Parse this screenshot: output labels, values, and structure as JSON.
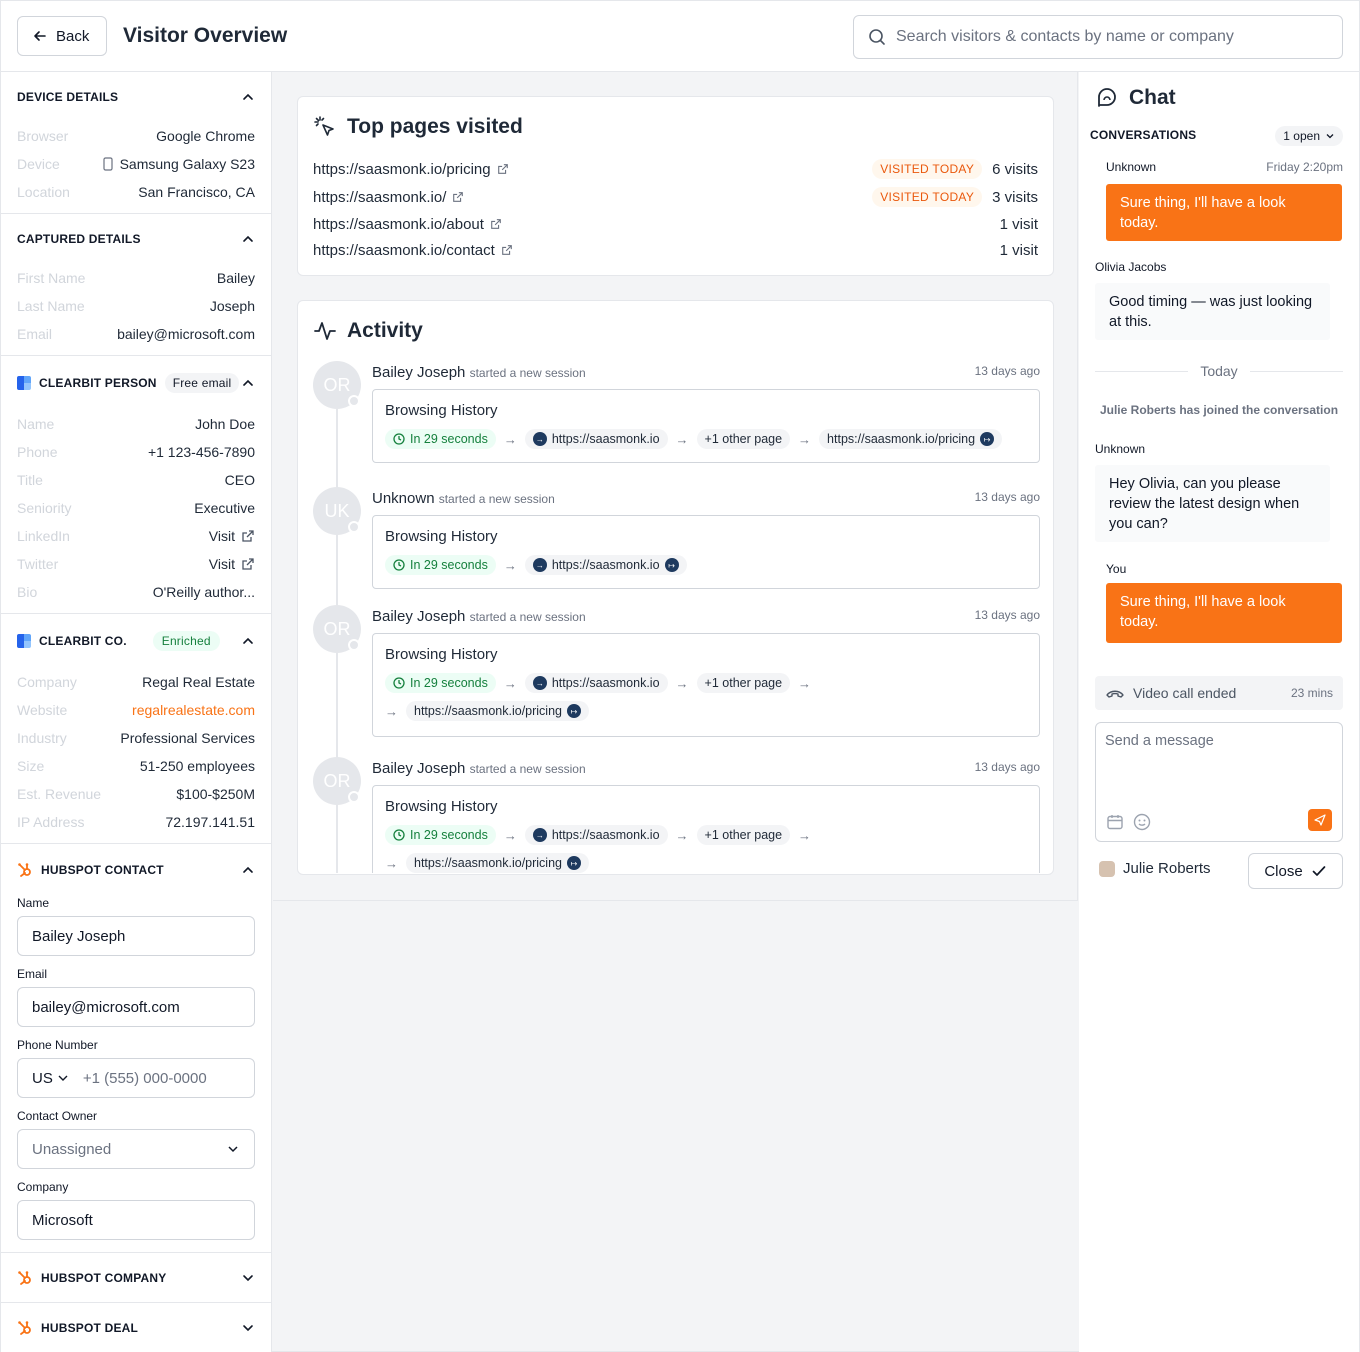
{
  "header": {
    "back_label": "Back",
    "title": "Visitor Overview",
    "search_placeholder": "Search visitors & contacts by name or company"
  },
  "device_details": {
    "title": "DEVICE DETAILS",
    "rows": [
      {
        "key": "Browser",
        "value": "Google Chrome"
      },
      {
        "key": "Device",
        "value": "Samsung Galaxy S23"
      },
      {
        "key": "Location",
        "value": "San Francisco, CA"
      }
    ]
  },
  "captured_details": {
    "title": "CAPTURED DETAILS",
    "rows": [
      {
        "key": "First Name",
        "value": "Bailey"
      },
      {
        "key": "Last Name",
        "value": "Joseph"
      },
      {
        "key": "Email",
        "value": "bailey@microsoft.com"
      }
    ]
  },
  "clearbit_person": {
    "title": "CLEARBIT PERSON",
    "badge": "Free email",
    "rows": [
      {
        "key": "Name",
        "value": "John Doe"
      },
      {
        "key": "Phone",
        "value": "+1 123-456-7890"
      },
      {
        "key": "Title",
        "value": "CEO"
      },
      {
        "key": "Seniority",
        "value": "Executive"
      },
      {
        "key": "LinkedIn",
        "value": "Visit"
      },
      {
        "key": "Twitter",
        "value": "Visit"
      },
      {
        "key": "Bio",
        "value": "O'Reilly author..."
      }
    ]
  },
  "clearbit_company": {
    "title": "CLEARBIT CO.",
    "badge": "Enriched",
    "rows": [
      {
        "key": "Company",
        "value": "Regal Real Estate"
      },
      {
        "key": "Website",
        "value": "regalrealestate.com"
      },
      {
        "key": "Industry",
        "value": "Professional Services"
      },
      {
        "key": "Size",
        "value": "51-250 employees"
      },
      {
        "key": "Est. Revenue",
        "value": "$100-$250M"
      },
      {
        "key": "IP Address",
        "value": "72.197.141.51"
      }
    ]
  },
  "hubspot_contact": {
    "title": "HUBSPOT CONTACT",
    "name_label": "Name",
    "name_value": "Bailey Joseph",
    "email_label": "Email",
    "email_value": "bailey@microsoft.com",
    "phone_label": "Phone Number",
    "phone_country": "US",
    "phone_placeholder": "+1 (555) 000-0000",
    "owner_label": "Contact Owner",
    "owner_value": "Unassigned",
    "company_label": "Company",
    "company_value": "Microsoft"
  },
  "hubspot_company": {
    "title": "HUBSPOT COMPANY"
  },
  "hubspot_deal": {
    "title": "HUBSPOT DEAL"
  },
  "top_pages": {
    "title": "Top pages visited",
    "pages": [
      {
        "url": "https://saasmonk.io/pricing",
        "badge": "VISITED TODAY",
        "visits": "6 visits"
      },
      {
        "url": "https://saasmonk.io/",
        "badge": "VISITED TODAY",
        "visits": "3 visits"
      },
      {
        "url": "https://saasmonk.io/about",
        "badge": "",
        "visits": "1 visit"
      },
      {
        "url": "https://saasmonk.io/contact",
        "badge": "",
        "visits": "1 visit"
      }
    ]
  },
  "activity": {
    "title": "Activity",
    "items": [
      {
        "initials": "OR",
        "name": "Bailey Joseph",
        "action": "started a new session",
        "time": "13 days ago",
        "bh_title": "Browsing History",
        "duration": "In 29 seconds",
        "first_url": "https://saasmonk.io",
        "other": "+1 other page",
        "last_url": "https://saasmonk.io/pricing"
      },
      {
        "initials": "UK",
        "name": "Unknown",
        "action": "started a new session",
        "time": "13 days ago",
        "bh_title": "Browsing History",
        "duration": "In 29 seconds",
        "first_url": "https://saasmonk.io"
      },
      {
        "initials": "OR",
        "name": "Bailey Joseph",
        "action": "started a new session",
        "time": "13 days ago",
        "bh_title": "Browsing History",
        "duration": "In 29 seconds",
        "first_url": "https://saasmonk.io",
        "other": "+1 other page",
        "last_url": "https://saasmonk.io/pricing"
      },
      {
        "initials": "OR",
        "name": "Bailey Joseph",
        "action": "started a new session",
        "time": "13 days ago",
        "bh_title": "Browsing History",
        "duration": "In 29 seconds",
        "first_url": "https://saasmonk.io",
        "other": "+1 other page",
        "last_url": "https://saasmonk.io/pricing"
      }
    ]
  },
  "chat": {
    "title": "Chat",
    "conversations_label": "CONVERSATIONS",
    "open_count": "1 open",
    "messages": [
      {
        "sender": "Unknown",
        "time": "Friday 2:20pm",
        "text": "Sure thing, I'll have a look today."
      },
      {
        "sender": "Olivia Jacobs",
        "text": "Good timing — was just looking at this."
      },
      {
        "divider": "Today"
      },
      {
        "system": "Julie Roberts has joined the conversation"
      },
      {
        "sender": "Unknown",
        "text": "Hey Olivia, can you please review the latest design when you can?"
      },
      {
        "sender": "You",
        "text": "Sure thing, I'll have a look today."
      }
    ],
    "video_ended_label": "Video call ended",
    "video_ended_time": "23 mins",
    "composer_placeholder": "Send a message",
    "assignee_name": "Julie Roberts",
    "close_label": "Close"
  }
}
